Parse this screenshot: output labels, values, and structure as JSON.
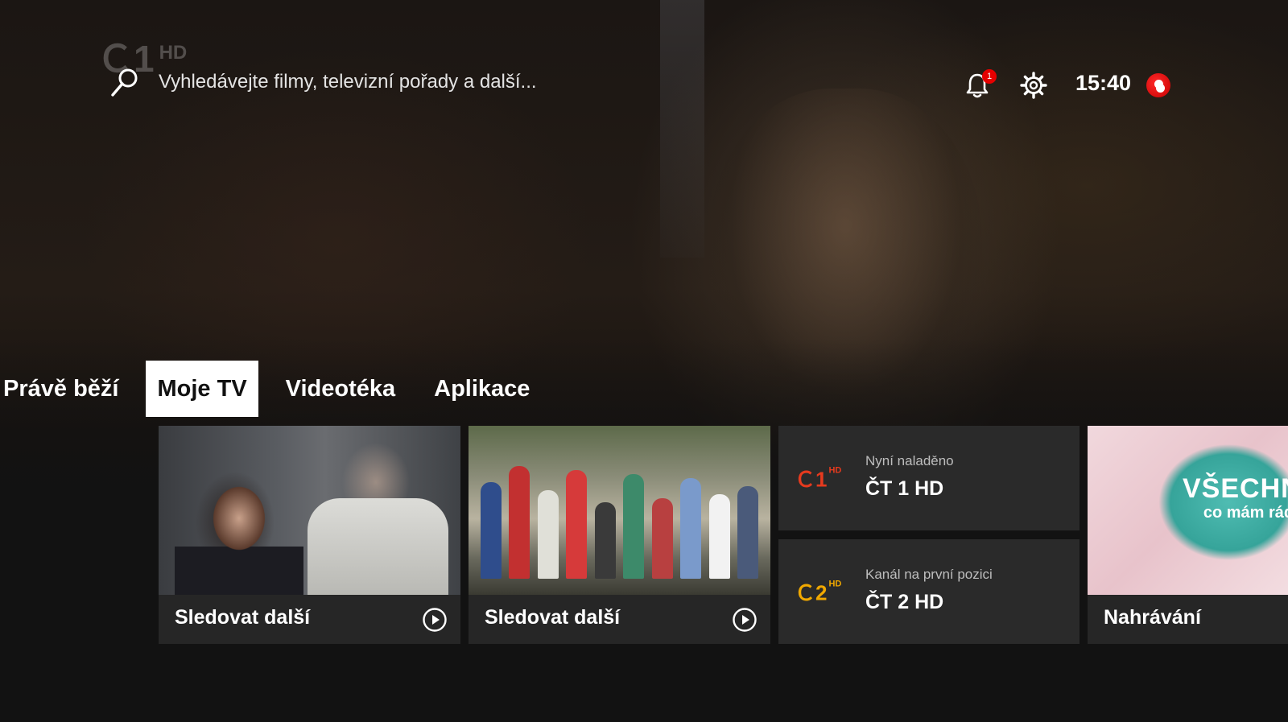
{
  "watermark": {
    "logo": "Ｃ1",
    "badge": "HD"
  },
  "header": {
    "search_placeholder": "Vyhledávejte filmy, televizní pořady a další...",
    "notification_count": "1",
    "time": "15:40"
  },
  "tabs": [
    {
      "label": "Právě běží",
      "active": false
    },
    {
      "label": "Moje TV",
      "active": true
    },
    {
      "label": "Videotéka",
      "active": false
    },
    {
      "label": "Aplikace",
      "active": false
    }
  ],
  "cards": {
    "continue_1": {
      "caption": "Sledovat další"
    },
    "continue_2": {
      "caption": "Sledovat další"
    },
    "live_now": {
      "logo": "Ｃ1",
      "logo_badge": "HD",
      "subtitle": "Nyní naladěno",
      "channel": "ČT 1 HD",
      "logo_color": "#e63a1e"
    },
    "first_position": {
      "logo": "Ｃ2",
      "logo_badge": "HD",
      "subtitle": "Kanál na první pozici",
      "channel": "ČT 2 HD",
      "logo_color": "#f0a800"
    },
    "recordings": {
      "caption": "Nahrávání",
      "art_title": "VŠECHNO",
      "art_subtitle": "co mám ráda"
    }
  },
  "colors": {
    "brand": "#e60000",
    "active_tab_bg": "#ffffff",
    "card_bg": "#262626"
  }
}
